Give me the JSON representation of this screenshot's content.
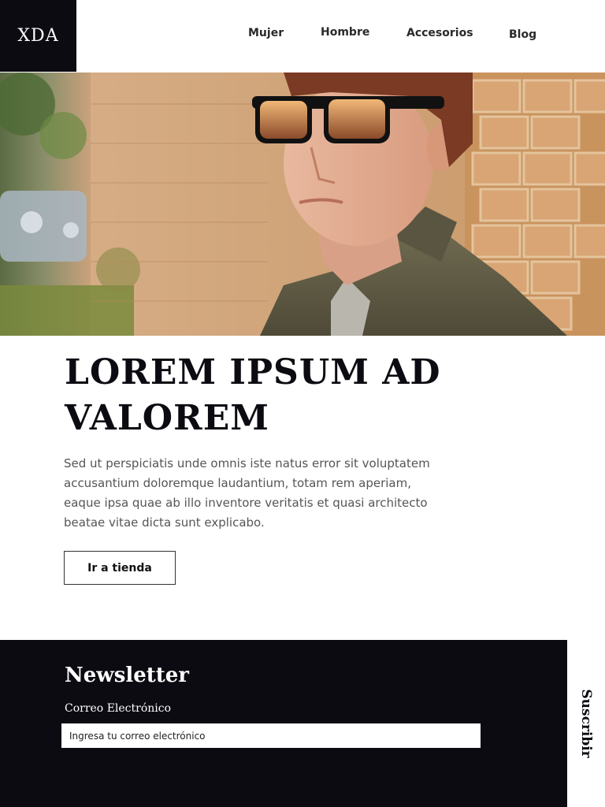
{
  "header": {
    "logo": "XDA",
    "nav": [
      "Mujer",
      "Hombre",
      "Accesorios",
      "Blog"
    ]
  },
  "hero": {
    "image": "photo-of-man-wearing-sunglasses-against-brick-wall"
  },
  "main": {
    "headline": "LOREM IPSUM AD VALOREM",
    "description": "Sed ut perspiciatis unde omnis iste natus error sit voluptatem accusantium doloremque laudantium, totam rem aperiam, eaque ipsa quae ab illo inventore veritatis et quasi architecto beatae vitae dicta sunt explicabo.",
    "cta_label": "Ir a tienda"
  },
  "newsletter": {
    "title": "Newsletter",
    "email_label": "Correo Electrónico",
    "email_placeholder": "Ingresa tu correo electrónico",
    "email_value": "",
    "subscribe_label": "Suscribir"
  },
  "colors": {
    "dark": "#0d0b12",
    "white": "#ffffff",
    "text_gray": "#555555"
  }
}
